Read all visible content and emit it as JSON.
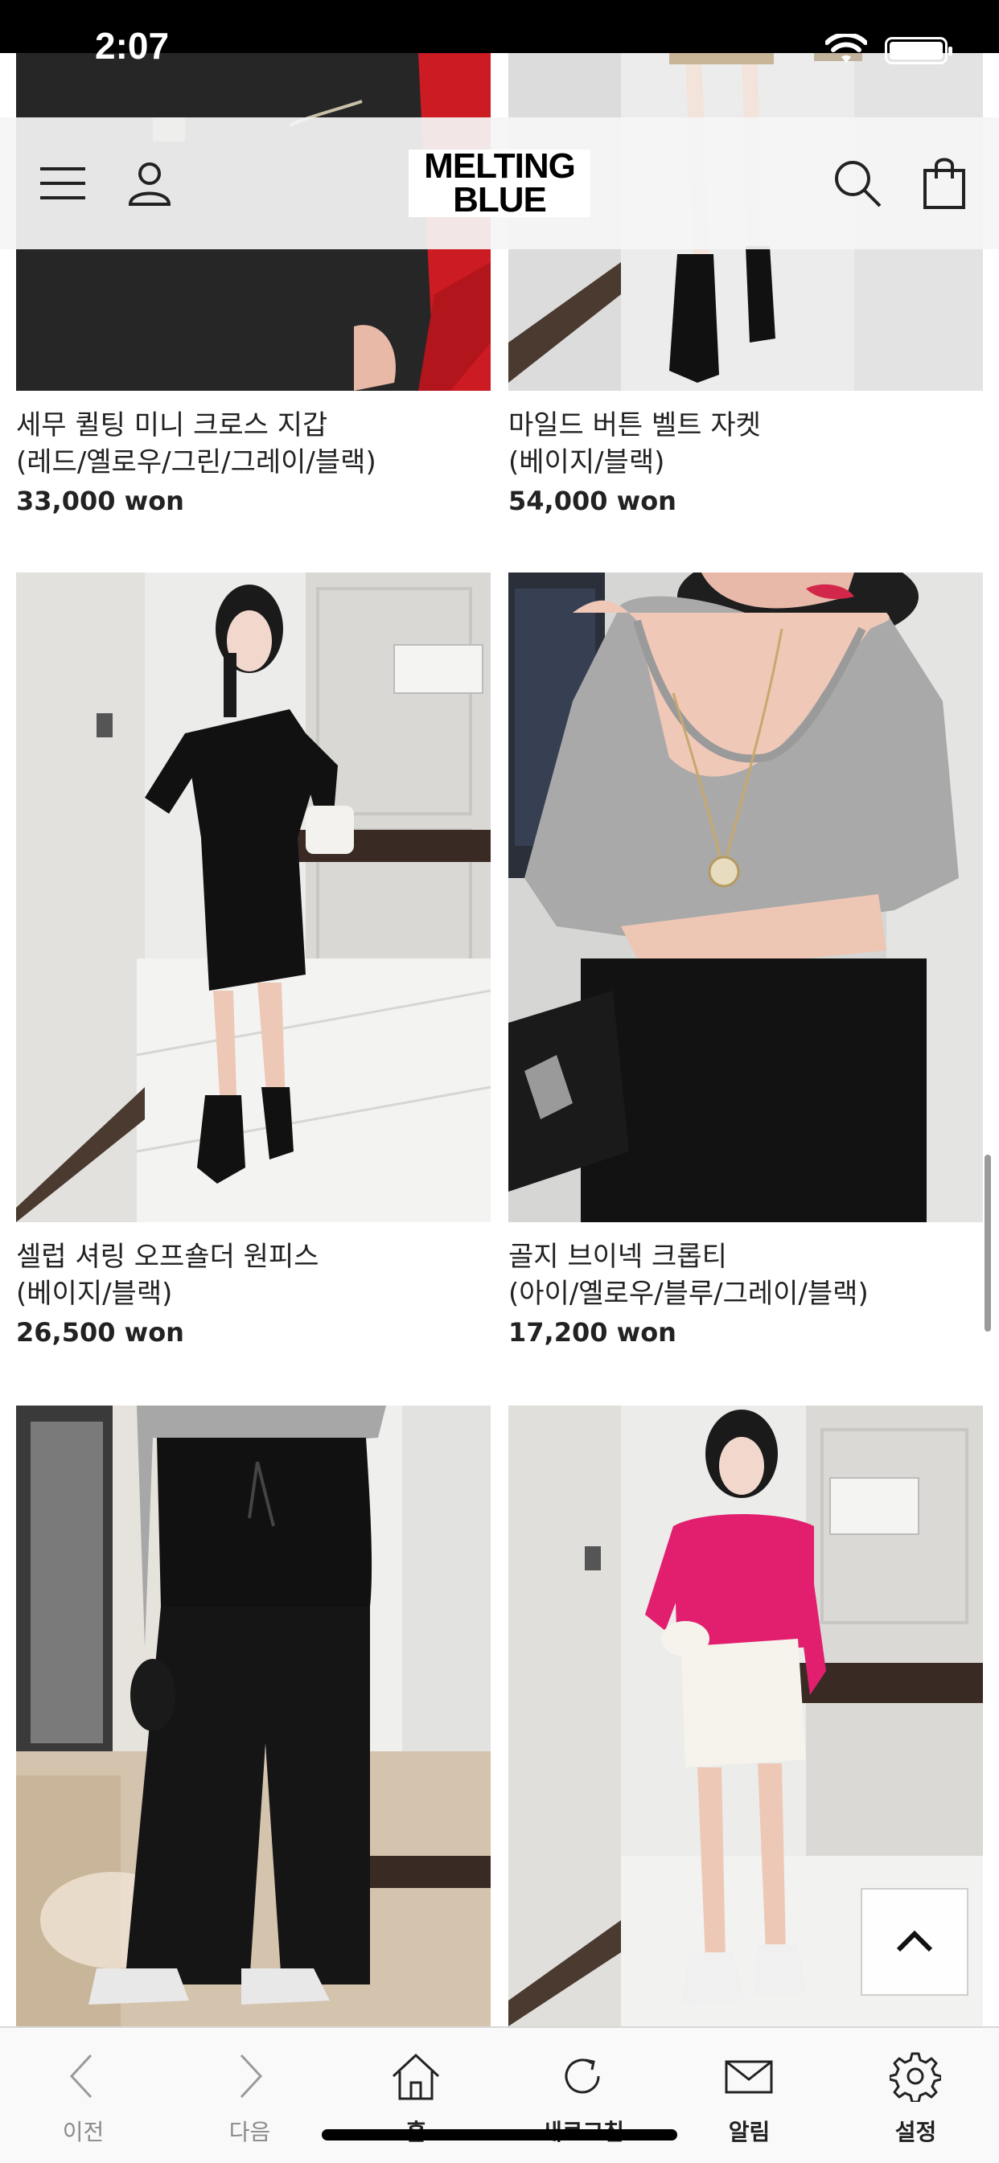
{
  "status_bar": {
    "time": "2:07"
  },
  "header": {
    "brand_line1": "MELTING",
    "brand_line2": "BLUE"
  },
  "products": [
    {
      "name_line1": "세무 퀼팅 미니 크로스 지갑",
      "name_line2": "(레드/옐로우/그린/그레이/블랙)",
      "price": "33,000 won"
    },
    {
      "name_line1": "마일드 버튼 벨트 자켓",
      "name_line2": "(베이지/블랙)",
      "price": "54,000 won"
    },
    {
      "name_line1": "셀럽 셔링 오프숄더 원피스",
      "name_line2": "(베이지/블랙)",
      "price": "26,500 won"
    },
    {
      "name_line1": "골지 브이넥 크롭티",
      "name_line2": "(아이/옐로우/블루/그레이/블랙)",
      "price": "17,200 won"
    }
  ],
  "bottom_nav": [
    {
      "label": "이전",
      "icon": "chevron-left-icon"
    },
    {
      "label": "다음",
      "icon": "chevron-right-icon"
    },
    {
      "label": "홈",
      "icon": "home-icon"
    },
    {
      "label": "새로고침",
      "icon": "refresh-icon"
    },
    {
      "label": "알림",
      "icon": "mail-icon"
    },
    {
      "label": "설정",
      "icon": "gear-icon"
    }
  ],
  "colors": {
    "accent_pink": "#e21f6f",
    "top_red": "#cc1b22",
    "header_bg": "#f5f5f5"
  }
}
